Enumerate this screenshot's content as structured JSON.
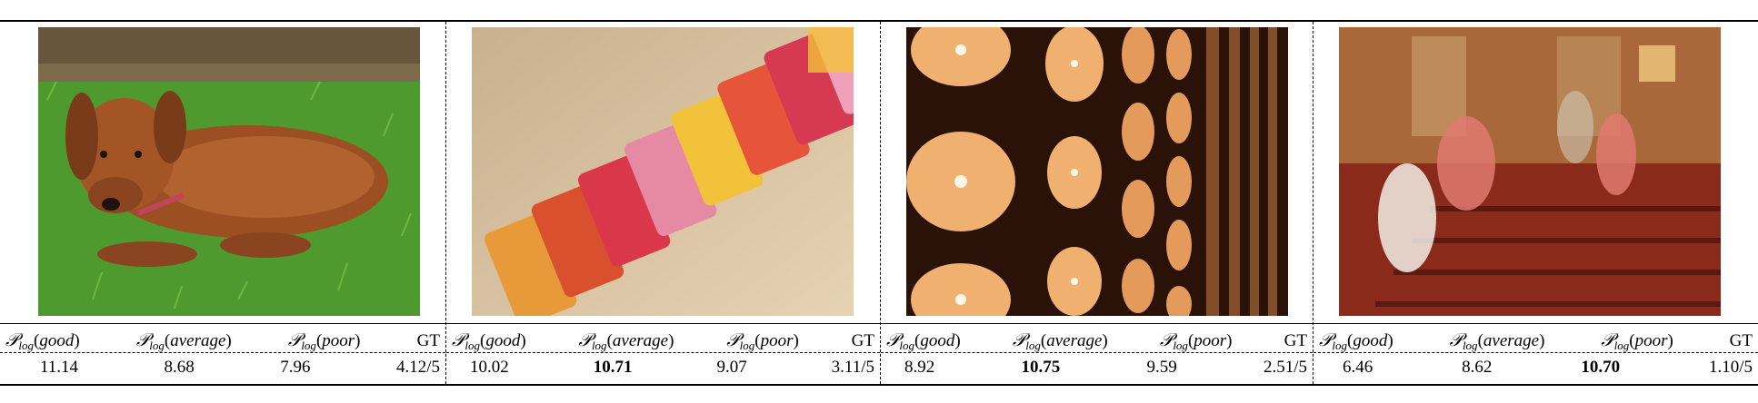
{
  "columns": [
    {
      "symbol": "𝒫",
      "sub": "log",
      "arg": "good",
      "paren_open": "(",
      "paren_close": ")"
    },
    {
      "symbol": "𝒫",
      "sub": "log",
      "arg": "average",
      "paren_open": "(",
      "paren_close": ")"
    },
    {
      "symbol": "𝒫",
      "sub": "log",
      "arg": "poor",
      "paren_open": "(",
      "paren_close": ")"
    },
    {
      "label": "GT"
    }
  ],
  "panels": [
    {
      "image": "dachshund-on-grass",
      "values": [
        "11.14",
        "8.68",
        "7.96",
        "4.12/5"
      ],
      "bold_index": 0
    },
    {
      "image": "candy-row-closeup",
      "values": [
        "10.02",
        "10.71",
        "9.07",
        "3.11/5"
      ],
      "bold_index": 1
    },
    {
      "image": "wall-of-lamps",
      "values": [
        "8.92",
        "10.75",
        "9.59",
        "2.51/5"
      ],
      "bold_index": 1
    },
    {
      "image": "blurred-church-interior",
      "values": [
        "6.46",
        "8.62",
        "10.70",
        "1.10/5"
      ],
      "bold_index": 2
    }
  ]
}
